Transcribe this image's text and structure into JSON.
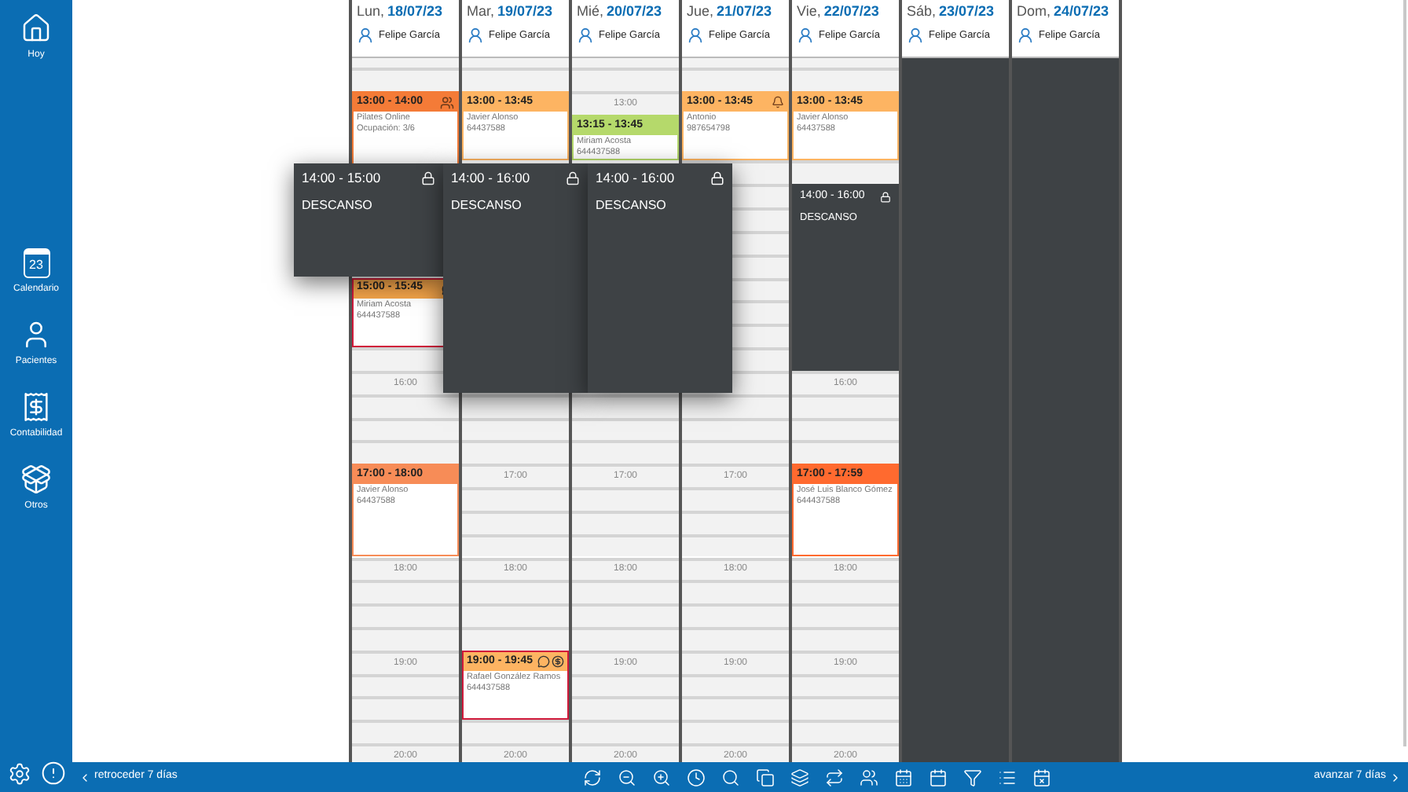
{
  "sidebar": {
    "items": [
      {
        "label": "Hoy",
        "kind": "home"
      },
      {
        "label": "Calendario",
        "kind": "calendar",
        "icon_text": "23"
      },
      {
        "label": "Pacientes",
        "kind": "patients"
      },
      {
        "label": "Contabilidad",
        "kind": "accounting"
      },
      {
        "label": "Otros",
        "kind": "other"
      }
    ]
  },
  "days": [
    {
      "weekday": "Lun,",
      "date": "18/07/23",
      "staff": "Felipe García",
      "closed": false,
      "hour_labels": [
        "16:00",
        "18:00",
        "19:00",
        "20:00"
      ],
      "appointments": [
        {
          "time": "13:00 - 14:00",
          "lines": [
            "Pilates Online",
            "Ocupación: 3/6"
          ],
          "color": "#f47b37",
          "flagged": false
        },
        {
          "time": "15:00 - 15:45",
          "lines": [
            "Miriam Acosta",
            "644437588"
          ],
          "color": "#f5a54a",
          "flagged": true
        },
        {
          "time": "17:00 - 18:00",
          "lines": [
            "Javier Alonso",
            "64437588"
          ],
          "color": "#f78c57",
          "flagged": false
        }
      ]
    },
    {
      "weekday": "Mar,",
      "date": "19/07/23",
      "staff": "Felipe García",
      "closed": false,
      "hour_labels": [
        "17:00",
        "18:00",
        "20:00"
      ],
      "appointments": [
        {
          "time": "13:00 - 13:45",
          "lines": [
            "Javier Alonso",
            "64437588"
          ],
          "color": "#fdb462",
          "flagged": false
        },
        {
          "time": "19:00 - 19:45",
          "lines": [
            "Rafael González Ramos",
            "644437588"
          ],
          "color": "#fdb462",
          "flagged": true
        }
      ]
    },
    {
      "weekday": "Mié,",
      "date": "20/07/23",
      "staff": "Felipe García",
      "closed": false,
      "hour_labels": [
        "13:00",
        "17:00",
        "18:00",
        "19:00",
        "20:00"
      ],
      "appointments": [
        {
          "time": "13:15 - 13:45",
          "lines": [
            "Miriam Acosta",
            "644437588"
          ],
          "color": "#b5d96b",
          "flagged": false
        }
      ]
    },
    {
      "weekday": "Jue,",
      "date": "21/07/23",
      "staff": "Felipe García",
      "closed": false,
      "hour_labels": [
        "17:00",
        "18:00",
        "19:00",
        "20:00"
      ],
      "appointments": [
        {
          "time": "13:00 - 13:45",
          "lines": [
            "Antonio",
            "987654798"
          ],
          "color": "#fdb462",
          "flagged": false
        }
      ]
    },
    {
      "weekday": "Vie,",
      "date": "22/07/23",
      "staff": "Felipe García",
      "closed": false,
      "hour_labels": [
        "16:00",
        "18:00",
        "19:00",
        "20:00"
      ],
      "appointments": [
        {
          "time": "13:00 - 13:45",
          "lines": [
            "Javier Alonso",
            "64437588"
          ],
          "color": "#fdb462",
          "flagged": false
        },
        {
          "time": "17:00 - 17:59",
          "lines": [
            "José Luis Blanco Gómez",
            "644437588"
          ],
          "color": "#ff6a2f",
          "flagged": false
        }
      ],
      "breaks": [
        {
          "time": "14:00 - 16:00",
          "label": "DESCANSO"
        }
      ]
    },
    {
      "weekday": "Sáb,",
      "date": "23/07/23",
      "staff": "Felipe García",
      "closed": true
    },
    {
      "weekday": "Dom,",
      "date": "24/07/23",
      "staff": "Felipe García",
      "closed": true
    }
  ],
  "break_popups": [
    {
      "time": "14:00 - 15:00",
      "label": "DESCANSO"
    },
    {
      "time": "14:00 - 16:00",
      "label": "DESCANSO"
    },
    {
      "time": "14:00 - 16:00",
      "label": "DESCANSO"
    }
  ],
  "bottom_bar": {
    "back": "retroceder 7 días",
    "forward": "avanzar 7 días"
  }
}
